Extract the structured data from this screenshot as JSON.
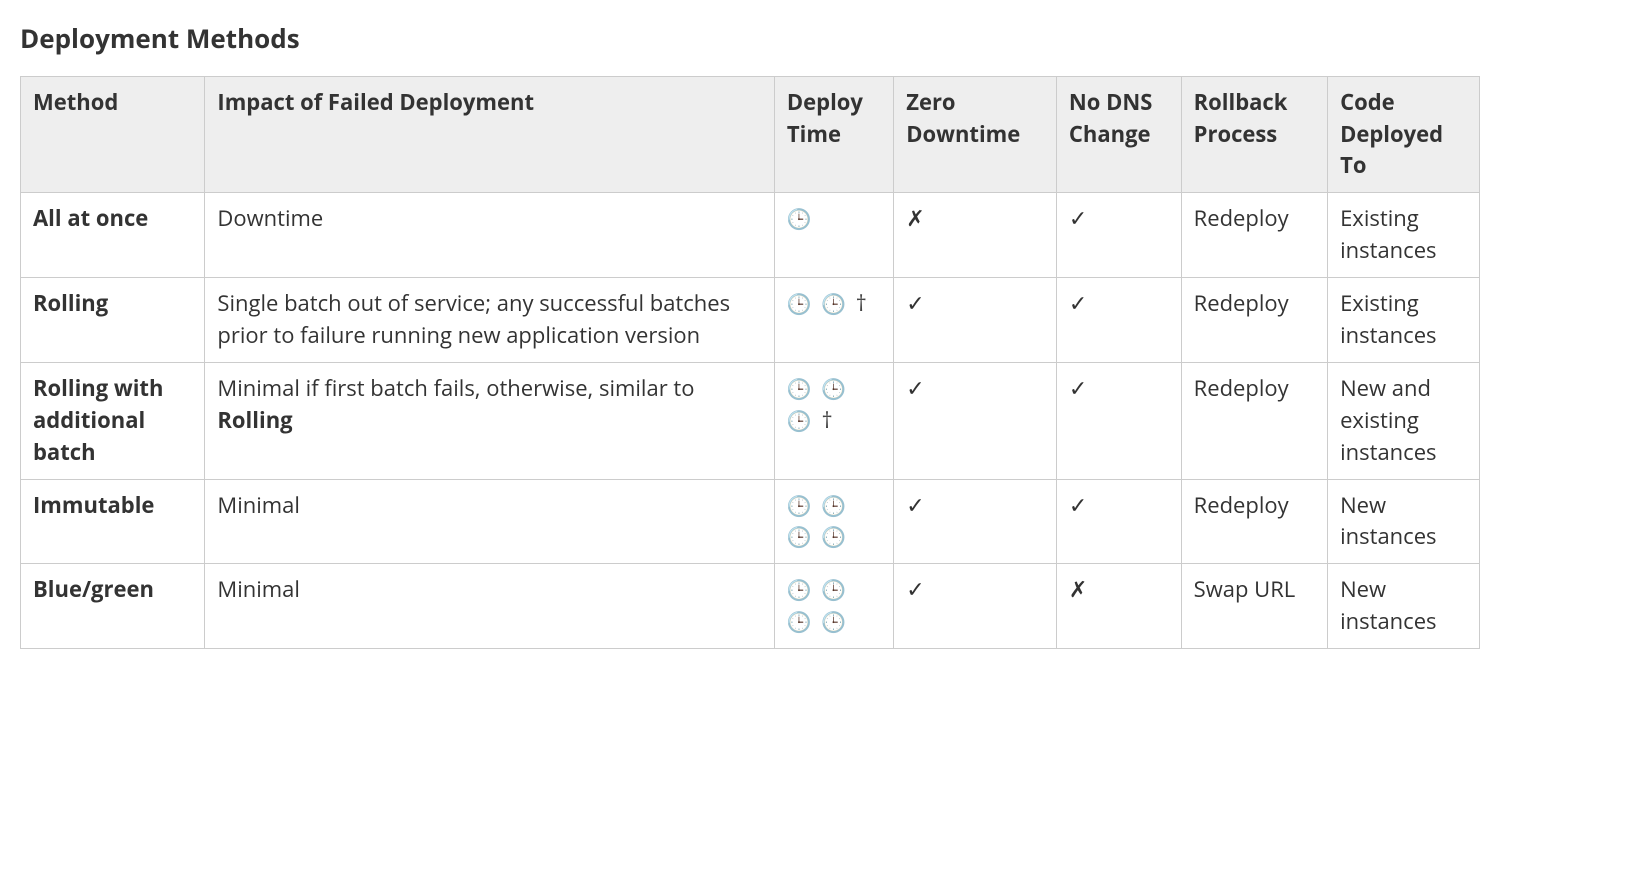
{
  "title": "Deployment Methods",
  "symbols": {
    "clock": "🕒",
    "check": "✓",
    "cross": "✗",
    "dagger": "†"
  },
  "chart_data": {
    "type": "table",
    "headers": [
      "Method",
      "Impact of Failed Deployment",
      "Deploy Time",
      "Zero Downtime",
      "No DNS Change",
      "Rollback Process",
      "Code Deployed To"
    ],
    "rows": [
      {
        "method": "All at once",
        "impact": {
          "prefix": "Downtime",
          "bold": "",
          "suffix": ""
        },
        "deploy_clocks": 1,
        "deploy_dagger": false,
        "zero_downtime": false,
        "no_dns_change": true,
        "rollback": "Redeploy",
        "code_deployed_to": "Existing instances"
      },
      {
        "method": "Rolling",
        "impact": {
          "prefix": "Single batch out of service; any successful batches prior to failure running new application version",
          "bold": "",
          "suffix": ""
        },
        "deploy_clocks": 2,
        "deploy_dagger": true,
        "zero_downtime": true,
        "no_dns_change": true,
        "rollback": "Redeploy",
        "code_deployed_to": "Existing instances"
      },
      {
        "method": "Rolling with additional batch",
        "impact": {
          "prefix": "Minimal if first batch fails, otherwise, similar to ",
          "bold": "Rolling",
          "suffix": ""
        },
        "deploy_clocks": 3,
        "deploy_dagger": true,
        "zero_downtime": true,
        "no_dns_change": true,
        "rollback": "Redeploy",
        "code_deployed_to": "New and existing instances"
      },
      {
        "method": "Immutable",
        "impact": {
          "prefix": "Minimal",
          "bold": "",
          "suffix": ""
        },
        "deploy_clocks": 4,
        "deploy_dagger": false,
        "zero_downtime": true,
        "no_dns_change": true,
        "rollback": "Redeploy",
        "code_deployed_to": "New instances"
      },
      {
        "method": "Blue/green",
        "impact": {
          "prefix": "Minimal",
          "bold": "",
          "suffix": ""
        },
        "deploy_clocks": 4,
        "deploy_dagger": false,
        "zero_downtime": true,
        "no_dns_change": false,
        "rollback": "Swap URL",
        "code_deployed_to": "New instances"
      }
    ]
  }
}
